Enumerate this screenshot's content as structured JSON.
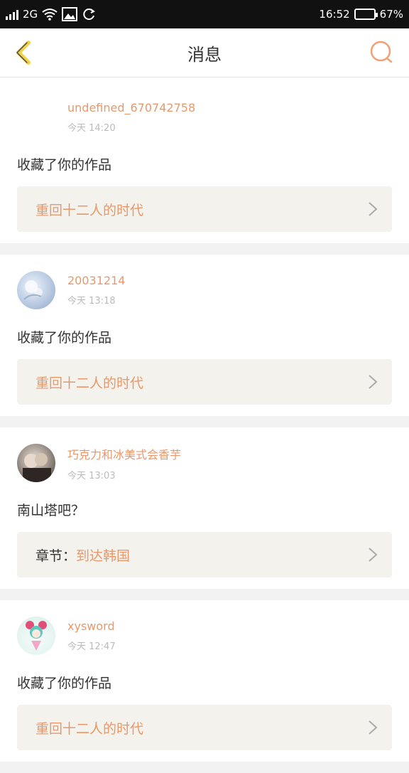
{
  "status_bar": {
    "signal_text": "2G",
    "time": "16:52",
    "battery": "67%",
    "battery_level": 0.67,
    "icons": [
      "signal-icon",
      "wifi-icon",
      "image-icon",
      "sync-icon",
      "battery-icon"
    ]
  },
  "header": {
    "title": "消息",
    "back_icon": "chevron-left-icon",
    "search_icon": "search-icon",
    "accent_color": "#e8986b"
  },
  "messages": [
    {
      "username": "undefined_670742758",
      "time": "今天 14:20",
      "action": "收藏了你的作品",
      "target_prefix": "",
      "target": "重回十二人的时代"
    },
    {
      "username": "20031214",
      "time": "今天 13:18",
      "action": "收藏了你的作品",
      "target_prefix": "",
      "target": "重回十二人的时代"
    },
    {
      "username": "巧克力和冰美式会香芋",
      "time": "今天 13:03",
      "action": "南山塔吧？",
      "target_prefix": "章节：",
      "target": "到达韩国"
    },
    {
      "username": "xysword",
      "time": "今天 12:47",
      "action": "收藏了你的作品",
      "target_prefix": "",
      "target": "重回十二人的时代"
    }
  ]
}
